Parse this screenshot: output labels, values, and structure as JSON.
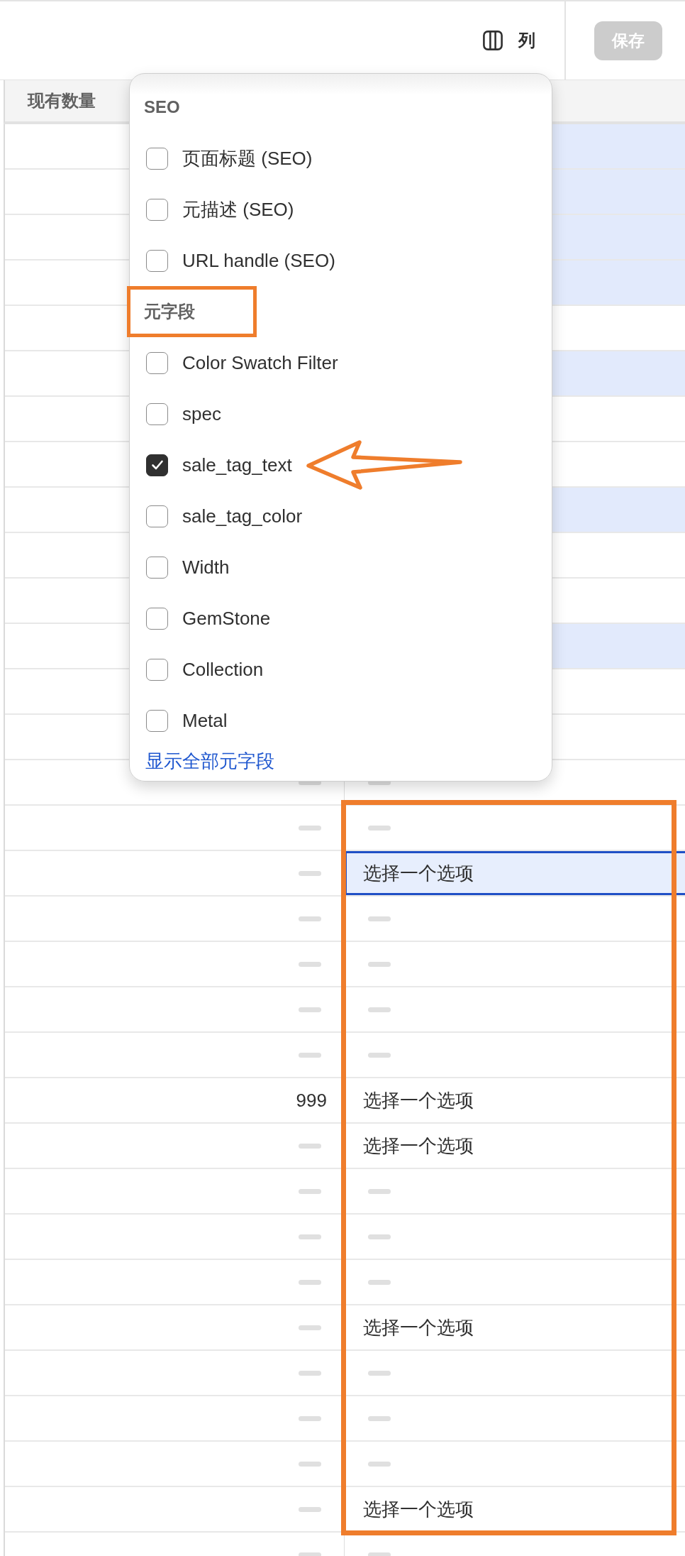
{
  "toolbar": {
    "columns_button": {
      "label": "列"
    },
    "save_button": {
      "label": "保存",
      "disabled": true
    }
  },
  "table": {
    "columns": [
      "现有数量"
    ],
    "row_groups": [
      {
        "boxed": false,
        "rows": [
          {
            "highlighted": true,
            "selected": false
          },
          {
            "highlighted": true,
            "selected": false
          },
          {
            "highlighted": true,
            "selected": false
          },
          {
            "highlighted": true,
            "selected": false
          },
          {
            "highlighted": false,
            "selected": false
          },
          {
            "highlighted": true,
            "selected": false
          },
          {
            "highlighted": false,
            "selected": false
          },
          {
            "highlighted": false,
            "selected": false
          },
          {
            "highlighted": true,
            "selected": false
          },
          {
            "highlighted": false,
            "selected": false
          },
          {
            "highlighted": false,
            "selected": false
          },
          {
            "highlighted": true,
            "selected": false
          },
          {
            "highlighted": false,
            "selected": false
          },
          {
            "highlighted": false,
            "selected": false
          },
          {
            "highlighted": false,
            "selected": false,
            "quantity": {
              "kind": "empty"
            },
            "value": {
              "kind": "empty"
            }
          }
        ]
      },
      {
        "boxed": true,
        "rows": [
          {
            "highlighted": false,
            "selected": false,
            "quantity": {
              "kind": "empty"
            },
            "value": {
              "kind": "empty"
            }
          },
          {
            "highlighted": false,
            "selected": true,
            "quantity": {
              "kind": "empty"
            },
            "value": {
              "kind": "select",
              "placeholder": "选择一个选项"
            }
          },
          {
            "highlighted": false,
            "selected": false,
            "quantity": {
              "kind": "empty"
            },
            "value": {
              "kind": "empty"
            }
          },
          {
            "highlighted": false,
            "selected": false,
            "quantity": {
              "kind": "empty"
            },
            "value": {
              "kind": "empty"
            }
          },
          {
            "highlighted": false,
            "selected": false,
            "quantity": {
              "kind": "empty"
            },
            "value": {
              "kind": "empty"
            }
          },
          {
            "highlighted": false,
            "selected": false,
            "quantity": {
              "kind": "empty"
            },
            "value": {
              "kind": "empty"
            }
          },
          {
            "highlighted": false,
            "selected": false,
            "quantity": {
              "kind": "text",
              "text": "999"
            },
            "value": {
              "kind": "select",
              "placeholder": "选择一个选项"
            }
          },
          {
            "highlighted": false,
            "selected": false,
            "quantity": {
              "kind": "empty"
            },
            "value": {
              "kind": "select",
              "placeholder": "选择一个选项"
            }
          },
          {
            "highlighted": false,
            "selected": false,
            "quantity": {
              "kind": "empty"
            },
            "value": {
              "kind": "empty"
            }
          },
          {
            "highlighted": false,
            "selected": false,
            "quantity": {
              "kind": "empty"
            },
            "value": {
              "kind": "empty"
            }
          },
          {
            "highlighted": false,
            "selected": false,
            "quantity": {
              "kind": "empty"
            },
            "value": {
              "kind": "empty"
            }
          },
          {
            "highlighted": false,
            "selected": false,
            "quantity": {
              "kind": "empty"
            },
            "value": {
              "kind": "select",
              "placeholder": "选择一个选项"
            }
          },
          {
            "highlighted": false,
            "selected": false,
            "quantity": {
              "kind": "empty"
            },
            "value": {
              "kind": "empty"
            }
          },
          {
            "highlighted": false,
            "selected": false,
            "quantity": {
              "kind": "empty"
            },
            "value": {
              "kind": "empty"
            }
          },
          {
            "highlighted": false,
            "selected": false,
            "quantity": {
              "kind": "empty"
            },
            "value": {
              "kind": "empty"
            }
          },
          {
            "highlighted": false,
            "selected": false,
            "quantity": {
              "kind": "empty"
            },
            "value": {
              "kind": "select",
              "placeholder": "选择一个选项"
            }
          }
        ]
      },
      {
        "boxed": false,
        "rows": [
          {
            "highlighted": false,
            "selected": false,
            "quantity": {
              "kind": "empty"
            },
            "value": {
              "kind": "empty"
            }
          }
        ]
      }
    ]
  },
  "column_menu": {
    "sections": [
      {
        "title": "SEO",
        "boxed": false,
        "items": [
          {
            "label": "页面标题 (SEO)",
            "checked": false,
            "arrowed": false
          },
          {
            "label": "元描述 (SEO)",
            "checked": false,
            "arrowed": false
          },
          {
            "label": "URL handle (SEO)",
            "checked": false,
            "arrowed": false
          }
        ]
      },
      {
        "title": "元字段",
        "boxed": true,
        "items": [
          {
            "label": "Color Swatch Filter",
            "checked": false,
            "arrowed": false
          },
          {
            "label": "spec",
            "checked": false,
            "arrowed": false
          },
          {
            "label": "sale_tag_text",
            "checked": true,
            "arrowed": true
          },
          {
            "label": "sale_tag_color",
            "checked": false,
            "arrowed": false
          },
          {
            "label": "Width",
            "checked": false,
            "arrowed": false
          },
          {
            "label": "GemStone",
            "checked": false,
            "arrowed": false
          },
          {
            "label": "Collection",
            "checked": false,
            "arrowed": false
          },
          {
            "label": "Metal",
            "checked": false,
            "arrowed": false
          }
        ]
      }
    ],
    "link": "显示全部元字段"
  }
}
